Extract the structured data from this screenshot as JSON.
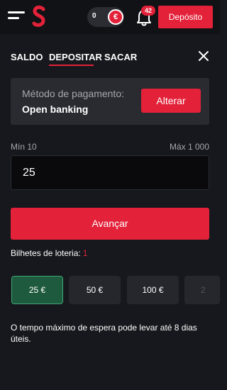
{
  "header": {
    "balance": "0",
    "currency_symbol": "€",
    "notification_count": "42",
    "deposit_label": "Depósito"
  },
  "tabs": [
    {
      "label": "SALDO",
      "active": false
    },
    {
      "label": "DEPOSITAR",
      "active": true
    },
    {
      "label": "SACAR",
      "active": false
    }
  ],
  "payment": {
    "label": "Método de pagamento:",
    "method": "Open banking",
    "change_label": "Alterar"
  },
  "limits": {
    "min": "Mín 10",
    "max": "Máx 1 000"
  },
  "amount_input": {
    "value": "25"
  },
  "advance_label": "Avançar",
  "lottery": {
    "label": "Bilhetes de loteria:",
    "count": "1"
  },
  "quick_amounts": [
    {
      "label": "25 €",
      "selected": true
    },
    {
      "label": "50 €",
      "selected": false
    },
    {
      "label": "100 €",
      "selected": false
    },
    {
      "label": "2",
      "selected": false
    }
  ],
  "note": "O tempo máximo de espera pode levar até 8 dias úteis.",
  "colors": {
    "accent": "#e32139",
    "background": "#17181d",
    "selected_chip": "#1e5a3e"
  },
  "icons": [
    "menu-icon",
    "logo-icon",
    "euro-icon",
    "bell-icon",
    "close-icon"
  ]
}
